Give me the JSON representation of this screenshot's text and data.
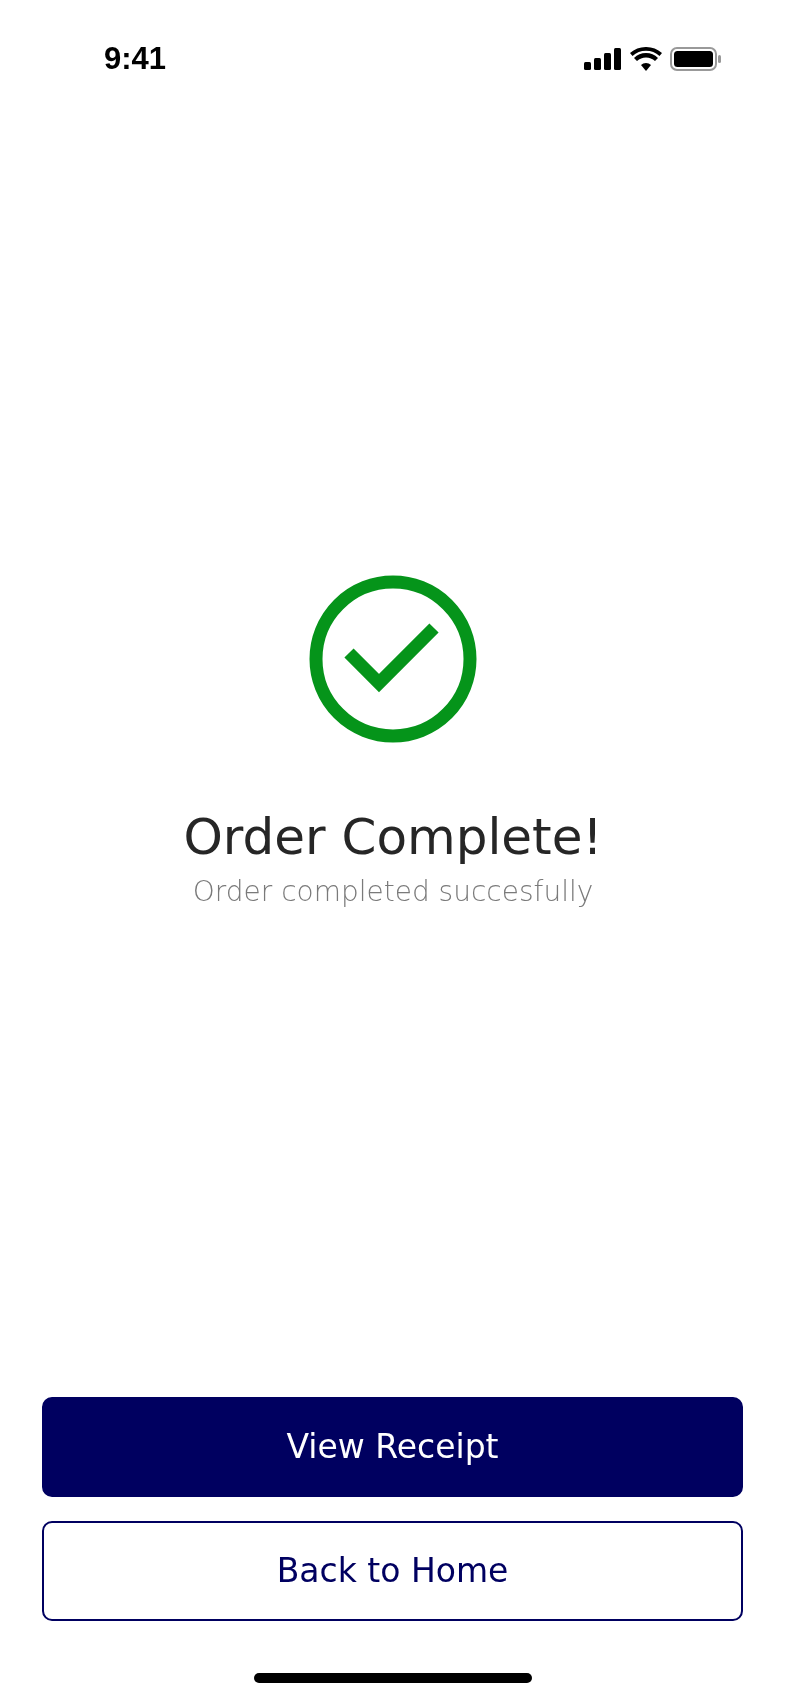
{
  "status_bar": {
    "time": "9:41"
  },
  "result": {
    "kind": "success",
    "title": "Order Complete!",
    "subtitle": "Order completed succesfully"
  },
  "buttons": [
    {
      "label": "View Receipt",
      "kind": "primary"
    },
    {
      "label": "Back to Home",
      "kind": "outline"
    }
  ]
}
